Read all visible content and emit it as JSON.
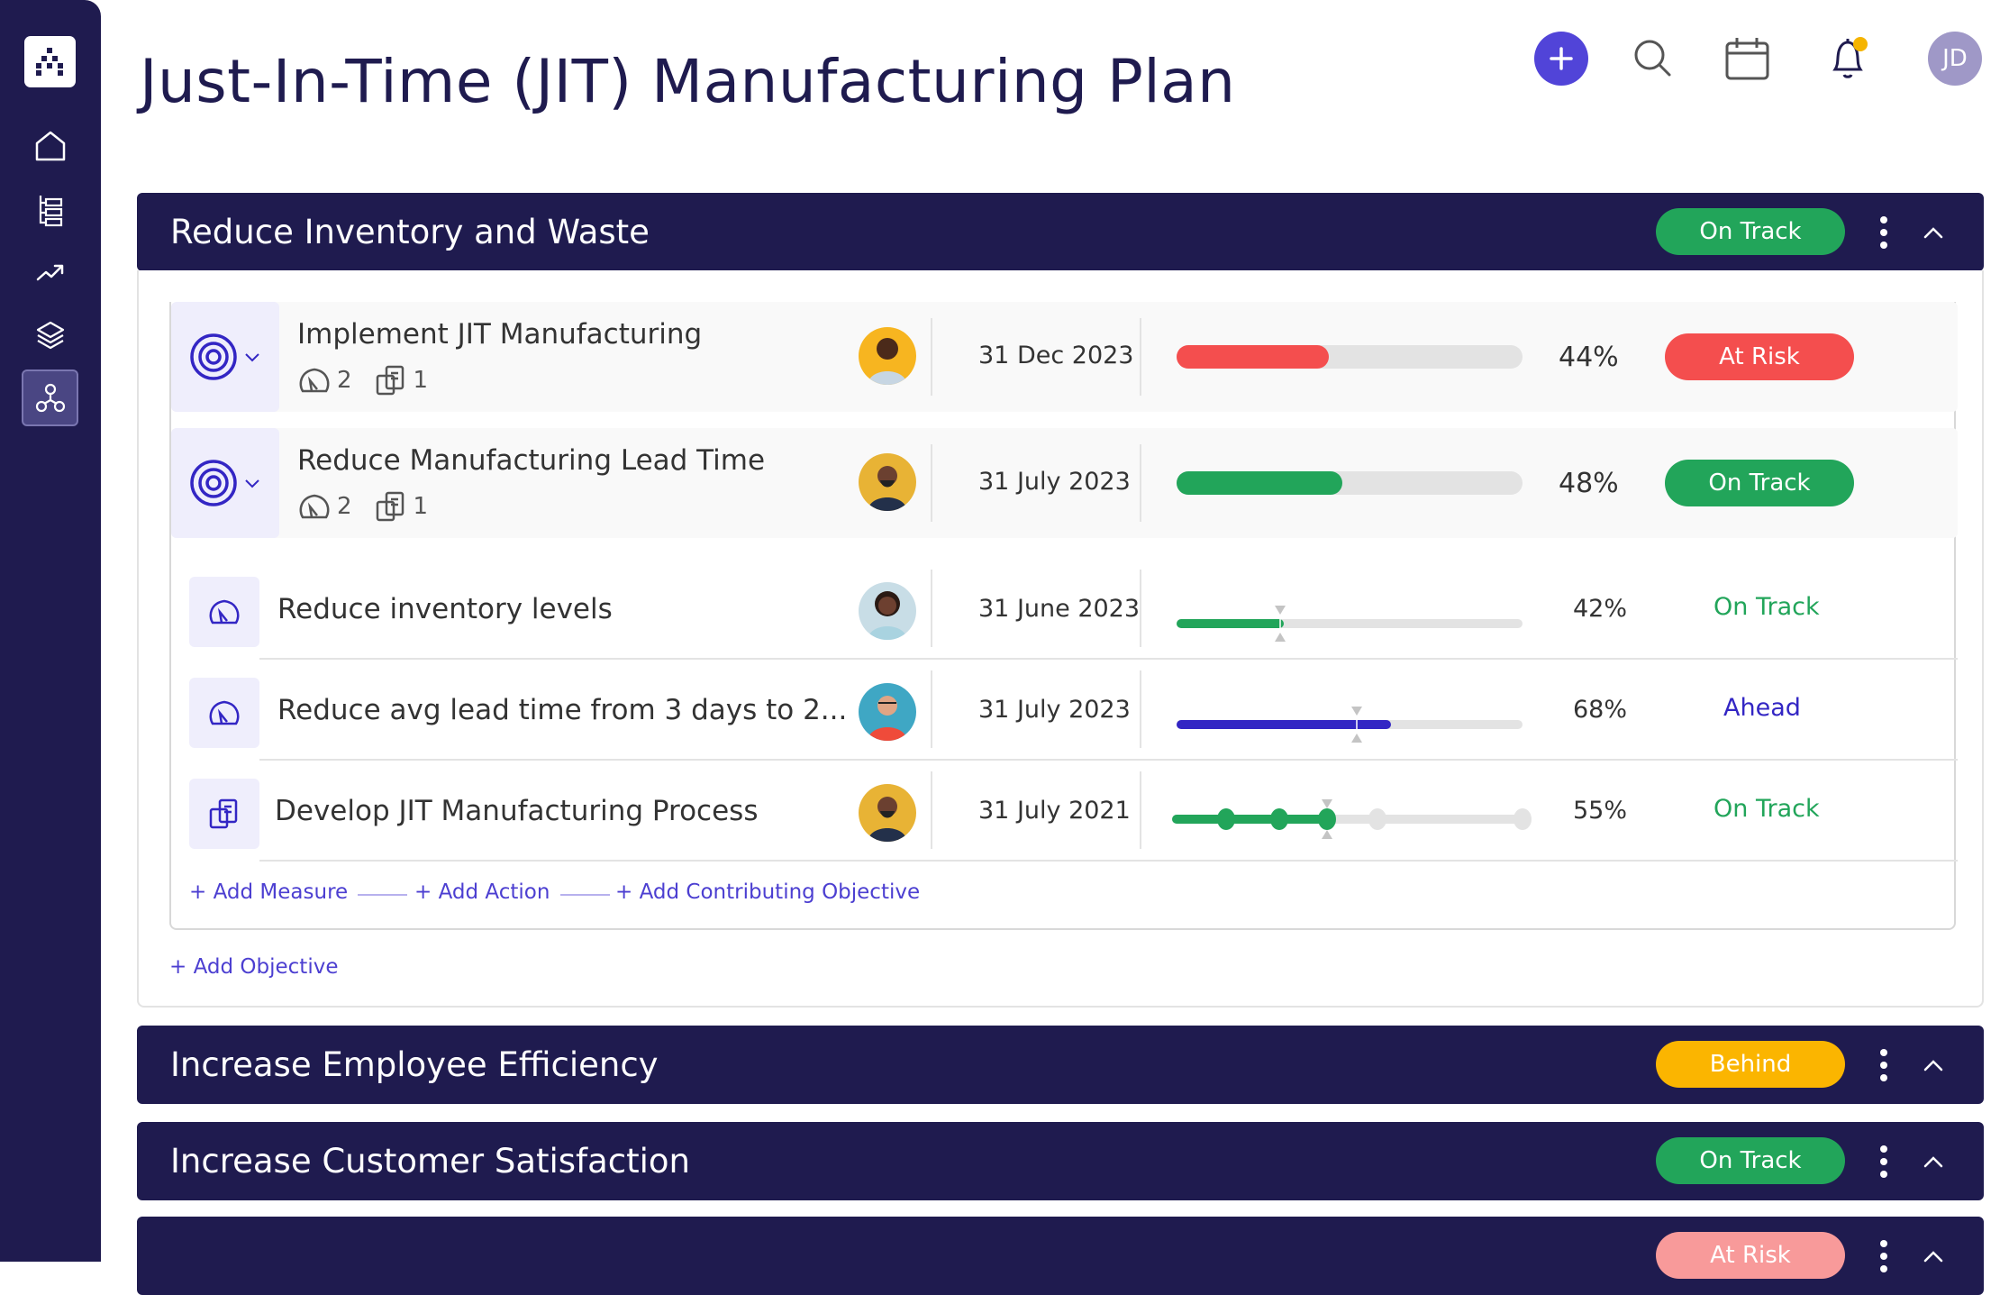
{
  "page": {
    "title": "Just-In-Time (JIT) Manufacturing Plan"
  },
  "sidebar": {
    "logo": "org-chart-logo-icon",
    "items": [
      {
        "name": "home",
        "icon": "home-icon"
      },
      {
        "name": "hierarchy",
        "icon": "hierarchy-list-icon"
      },
      {
        "name": "trends",
        "icon": "trend-up-icon"
      },
      {
        "name": "layers",
        "icon": "layers-icon"
      },
      {
        "name": "strategy-map",
        "icon": "connected-nodes-icon",
        "active": true
      }
    ]
  },
  "topbar": {
    "add": "plus-icon",
    "search": "search-icon",
    "calendar": "calendar-icon",
    "notifications": "bell-icon",
    "notification_dot_color": "#f5b400",
    "user_initials": "JD"
  },
  "colors": {
    "navy": "#1f1b4f",
    "accent": "#5144d8",
    "green": "#22a55a",
    "red": "#f44e4e",
    "amber": "#fbb500",
    "pink": "#f89a9a",
    "blue": "#3326c4"
  },
  "sections": [
    {
      "title": "Reduce Inventory and Waste",
      "status": "On Track",
      "expanded": true,
      "objectives": [
        {
          "name": "Implement JIT Manufacturing",
          "measures_count": "2",
          "actions_count": "1",
          "date": "31 Dec 2023",
          "progress": 44,
          "progress_label": "44%",
          "status": "At Risk"
        },
        {
          "name": "Reduce Manufacturing Lead Time",
          "measures_count": "2",
          "actions_count": "1",
          "date": "31 July 2023",
          "progress": 48,
          "progress_label": "48%",
          "status": "On Track"
        }
      ],
      "items": [
        {
          "type": "measure",
          "name": "Reduce inventory levels",
          "date": "31 June 2023",
          "progress": 31,
          "target": 30,
          "progress_label": "42%",
          "status": "On Track"
        },
        {
          "type": "measure",
          "name": "Reduce avg lead time from 3 days to 2...",
          "date": "31 July 2023",
          "progress": 62,
          "target": 52,
          "progress_label": "68%",
          "status": "Ahead"
        },
        {
          "type": "action",
          "name": "Develop JIT Manufacturing Process",
          "date": "31 July 2021",
          "milestones": 5,
          "milestones_done": 3,
          "progress_label": "55%",
          "status": "On Track"
        }
      ],
      "links": {
        "add_measure": "+ Add Measure",
        "add_action": "+ Add Action",
        "add_contributing": "+ Add Contributing Objective",
        "add_objective": "+ Add Objective"
      }
    },
    {
      "title": "Increase Employee Efficiency",
      "status": "Behind"
    },
    {
      "title": "Increase Customer Satisfaction",
      "status": "On Track"
    },
    {
      "title": "",
      "status": "At Risk"
    }
  ]
}
